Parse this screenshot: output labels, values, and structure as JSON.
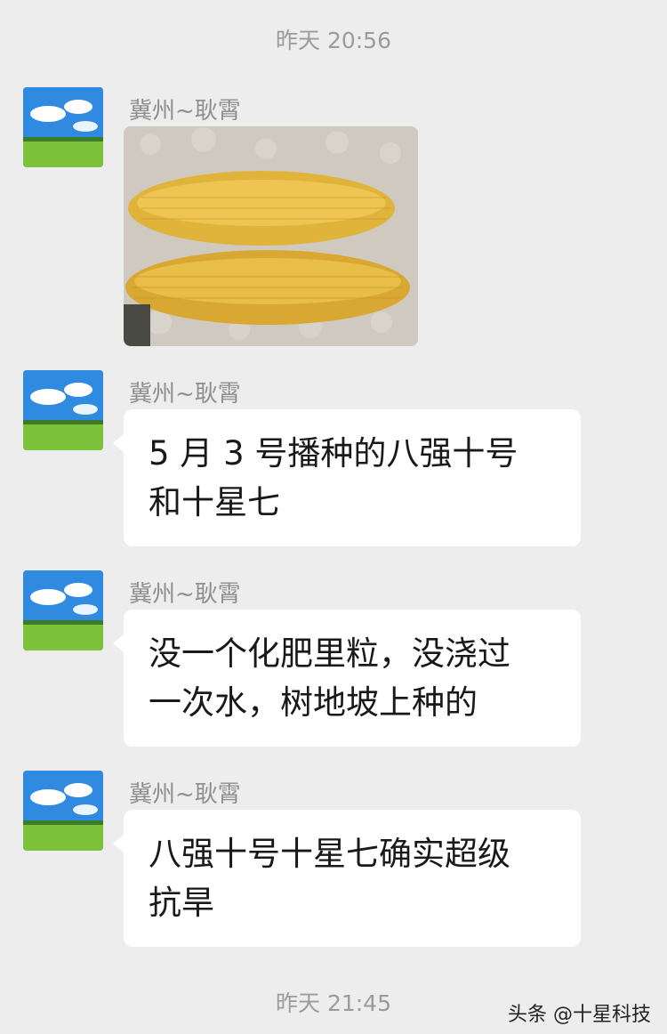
{
  "timestamps": {
    "top": "昨天 20:56",
    "bottom": "昨天 21:45"
  },
  "messages": [
    {
      "sender": "冀州~耿霄",
      "type": "image",
      "image": "two-corn-cobs-photo"
    },
    {
      "sender": "冀州~耿霄",
      "type": "text",
      "line1": "5 月 3 号播种的八强十号",
      "line2": "和十星七"
    },
    {
      "sender": "冀州~耿霄",
      "type": "text",
      "line1": "没一个化肥里粒，没浇过",
      "line2": "一次水，树地坡上种的"
    },
    {
      "sender": "冀州~耿霄",
      "type": "text",
      "line1": "八强十号十星七确实超级",
      "line2": "抗旱"
    }
  ],
  "watermark": "头条 @十星科技",
  "colors": {
    "background": "#ededed",
    "bubble": "#ffffff",
    "meta_text": "#9b9b9b"
  }
}
